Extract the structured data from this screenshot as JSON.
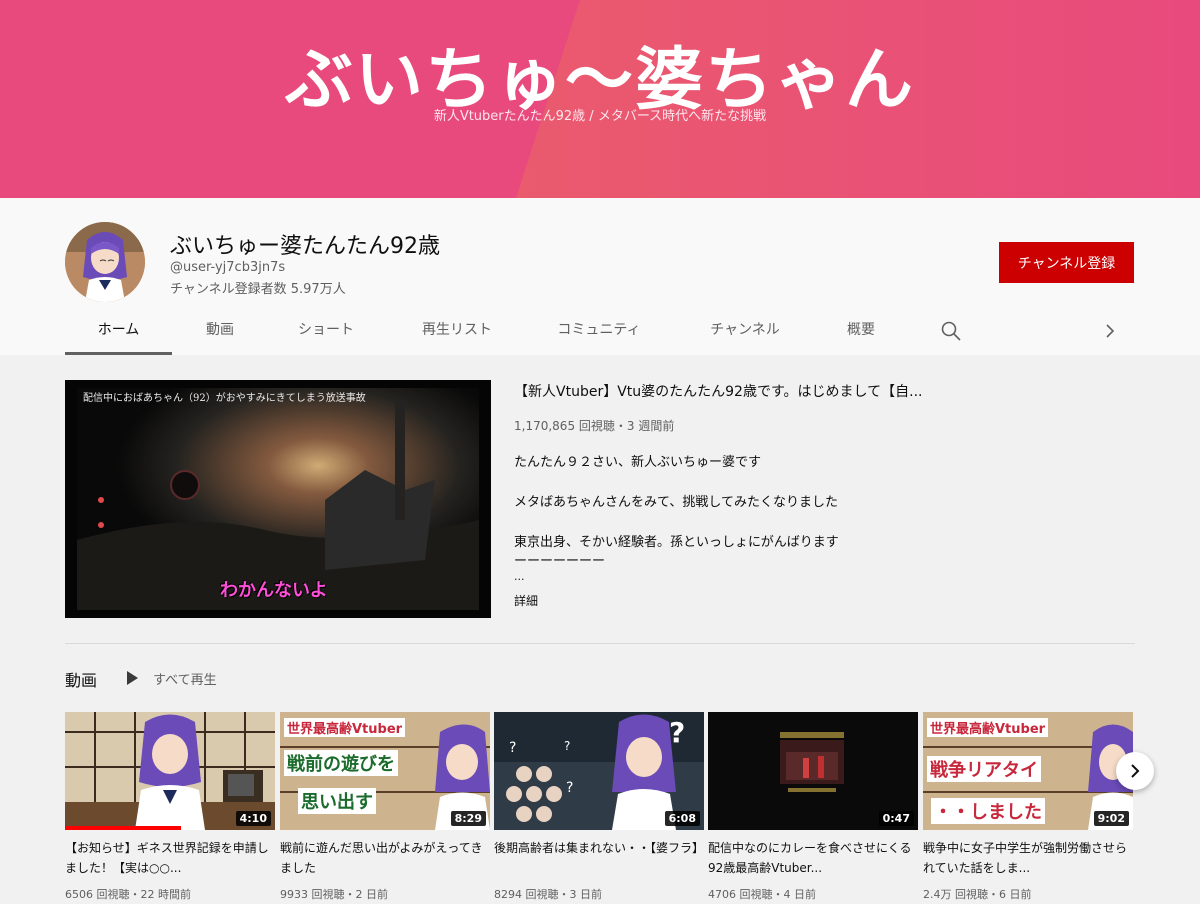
{
  "banner": {
    "title": "ぶいちゅ〜婆ちゃん",
    "subtitle": "新人Vtuberたんたん92歳 / メタバース時代へ新たな挑戦"
  },
  "channel": {
    "name": "ぶいちゅー婆たんたん92歳",
    "handle": "@user-yj7cb3jn7s",
    "subscribers": "チャンネル登録者数 5.97万人",
    "subscribe_label": "チャンネル登録"
  },
  "tabs": [
    {
      "label": "ホーム",
      "active": true
    },
    {
      "label": "動画"
    },
    {
      "label": "ショート"
    },
    {
      "label": "再生リスト"
    },
    {
      "label": "コミュニティ"
    },
    {
      "label": "チャンネル"
    },
    {
      "label": "概要"
    }
  ],
  "featured": {
    "title": "【新人Vtuber】Vtu婆のたんたん92歳です。はじめまして【自...",
    "meta": "1,170,865 回視聴・3 週間前",
    "overlay_caption": "配信中におばあちゃん（92）がおやすみにきてしまう放送事故",
    "overlay_subtitle": "わかんないよ",
    "description": [
      "たんたん９２さい、新人ぶいちゅー婆です",
      "メタばあちゃんさんをみて、挑戦してみたくなりました",
      "東京出身、そかい経験者。孫といっしょにがんばります",
      "ーーーーーーー",
      "..."
    ],
    "more_label": "詳細"
  },
  "section": {
    "title": "動画",
    "play_all": "すべて再生"
  },
  "videos": [
    {
      "title": "【お知らせ】ギネス世界記録を申請しました！【実は○○...",
      "meta": "6506 回視聴・22 時間前",
      "duration": "4:10",
      "progress": 0.55
    },
    {
      "title": "戦前に遊んだ思い出がよみがえってきました",
      "meta": "9933 回視聴・2 日前",
      "duration": "8:29",
      "thumb_line1": "世界最高齢Vtuber",
      "thumb_line2": "戦前の遊びを",
      "thumb_line3": "思い出す"
    },
    {
      "title": "後期高齢者は集まれない・・【婆フラ】",
      "meta": "8294 回視聴・3 日前",
      "duration": "6:08"
    },
    {
      "title": "配信中なのにカレーを食べさせにくる92歳最高齢Vtuber...",
      "meta": "4706 回視聴・4 日前",
      "duration": "0:47"
    },
    {
      "title": "戦争中に女子中学生が強制労働させられていた話をしま...",
      "meta": "2.4万 回視聴・6 日前",
      "duration": "9:02",
      "thumb_line1": "世界最高齢Vtuber",
      "thumb_line2": "戦争リアタイ",
      "thumb_line3": "・・しました"
    }
  ],
  "icons": {
    "search": "search-icon",
    "tabs_next": "chevron-right-icon",
    "play": "play-icon",
    "carousel_next": "chevron-right-icon"
  },
  "colors": {
    "banner_pink": "#e84a7d",
    "banner_orange": "#f07a52",
    "subscribe_red": "#cc0000",
    "progress_red": "#ff0000"
  }
}
